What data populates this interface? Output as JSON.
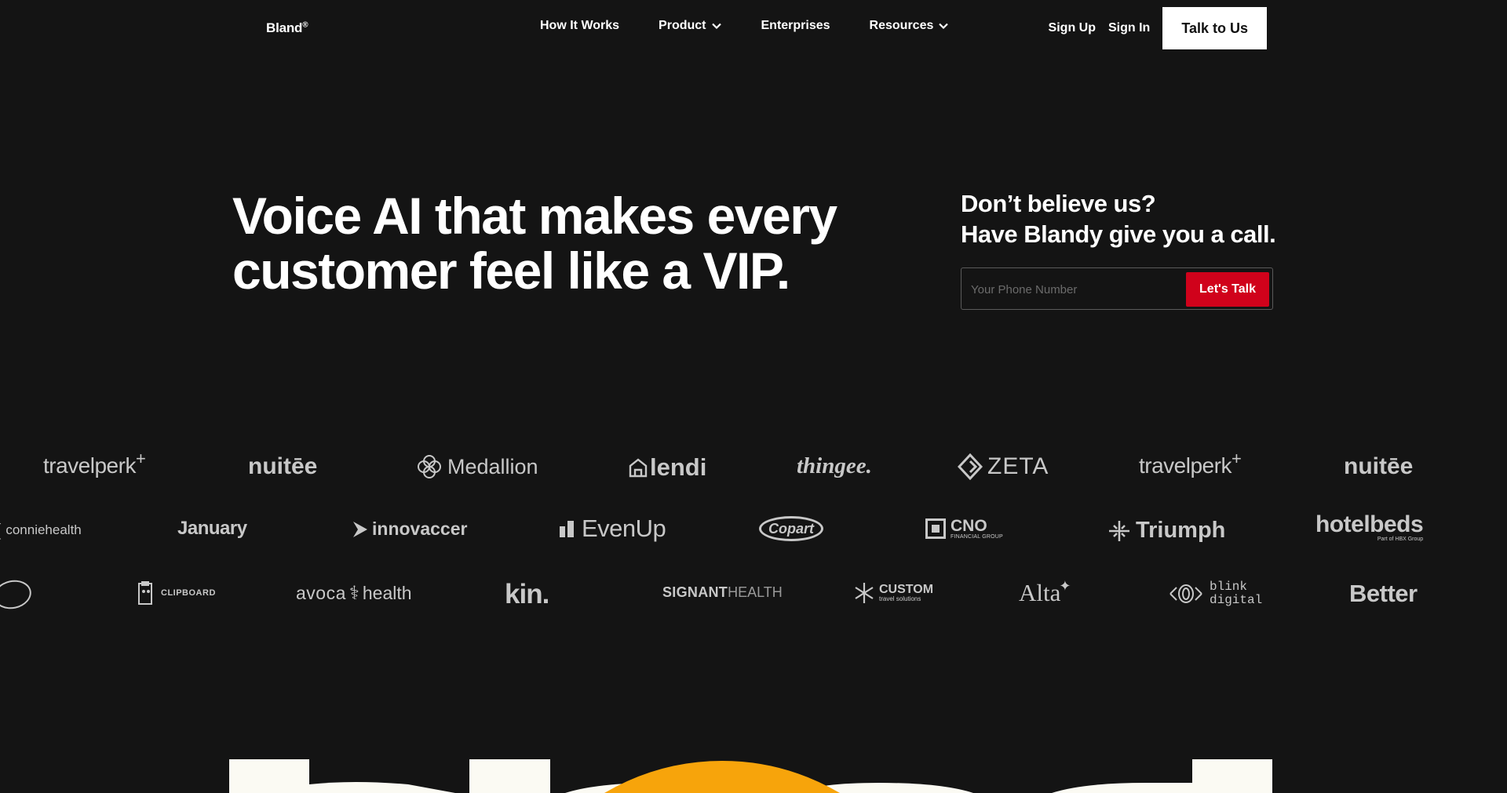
{
  "brand": {
    "name": "Bland",
    "mark": "®"
  },
  "nav": {
    "links": [
      {
        "label": "How It Works"
      },
      {
        "label": "Product"
      },
      {
        "label": "Enterprises"
      },
      {
        "label": "Resources"
      }
    ],
    "sign_up": "Sign Up",
    "sign_in": "Sign In",
    "talk_to_us": "Talk to Us"
  },
  "hero": {
    "title_line1": "Voice AI that makes every",
    "title_line2": "customer feel like a VIP."
  },
  "cta": {
    "title_line1": "Don’t believe us?",
    "title_line2": "Have Blandy give you a call.",
    "phone_placeholder": "Your Phone Number",
    "button_label": "Let's Talk"
  },
  "logos": {
    "row1": [
      "travelperk",
      "nuitēe",
      "Medallion",
      "lendi",
      "thingee.",
      "ZETA",
      "travelperk",
      "nuitēe"
    ],
    "row2": [
      "conniehealth",
      "January",
      "innovaccer",
      "EvenUp",
      "Copart",
      "CNO",
      "Triumph",
      "hotelbeds"
    ],
    "row2_sub": {
      "cno": "FINANCIAL GROUP",
      "hotelbeds": "Part of HBX Group"
    },
    "row3": [
      "CLIPBOARD",
      "avoca",
      "health",
      "kin.",
      "SIGNANT",
      "HEALTH",
      "CUSTOM",
      "Alta",
      "blink",
      "digital",
      "Better"
    ],
    "row3_sub": {
      "custom": "travel solutions"
    }
  },
  "colors": {
    "background": "#141414",
    "accent_red": "#d0021b",
    "logo_gray": "#c8c8c8",
    "art_cream": "#fbfaf3",
    "art_orange": "#f7a40b"
  }
}
